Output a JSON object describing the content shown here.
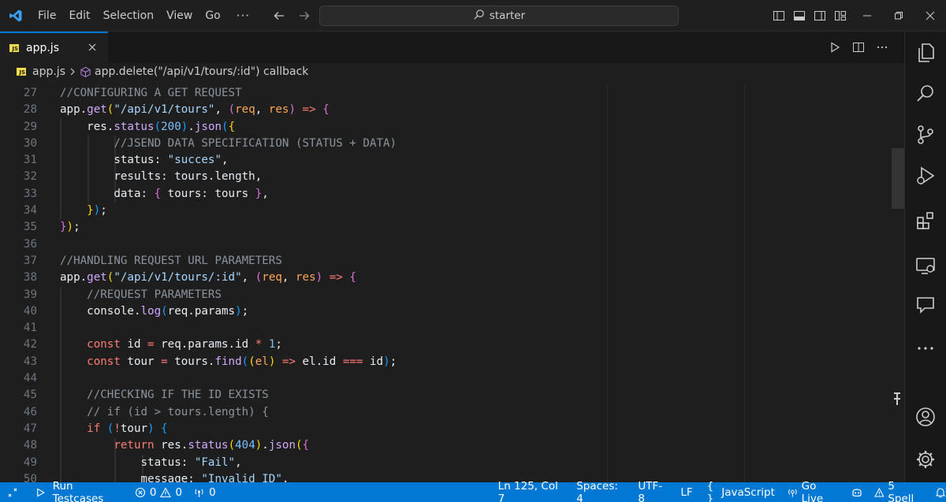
{
  "titlebar": {
    "menu": [
      "File",
      "Edit",
      "Selection",
      "View",
      "Go"
    ],
    "more": "···",
    "search": "starter"
  },
  "tab": {
    "badge": "JS",
    "label": "app.js"
  },
  "breadcrumb": {
    "badge": "JS",
    "file": "app.js",
    "symbol": "app.delete(\"/api/v1/tours/:id\") callback"
  },
  "editor": {
    "line_numbers": [
      "27",
      "28",
      "29",
      "30",
      "31",
      "32",
      "33",
      "34",
      "35",
      "36",
      "37",
      "38",
      "39",
      "40",
      "41",
      "42",
      "43",
      "44",
      "45",
      "46",
      "47",
      "48",
      "49",
      "50"
    ]
  },
  "statusbar": {
    "run_testcases": "Run Testcases",
    "errors": "0",
    "warnings": "0",
    "ports": "0",
    "position": "Ln 125, Col 7",
    "spaces": "Spaces: 4",
    "encoding": "UTF-8",
    "eol": "LF",
    "braces": "{ }",
    "language": "JavaScript",
    "golive": "Go Live",
    "spell": "5 Spell"
  },
  "colors": {
    "accent": "#0078d4",
    "editor_bg": "#1e1e1e",
    "comment": "#8b949e",
    "string": "#a5d6ff",
    "function": "#d2a8ff",
    "keyword": "#ff7b72"
  }
}
